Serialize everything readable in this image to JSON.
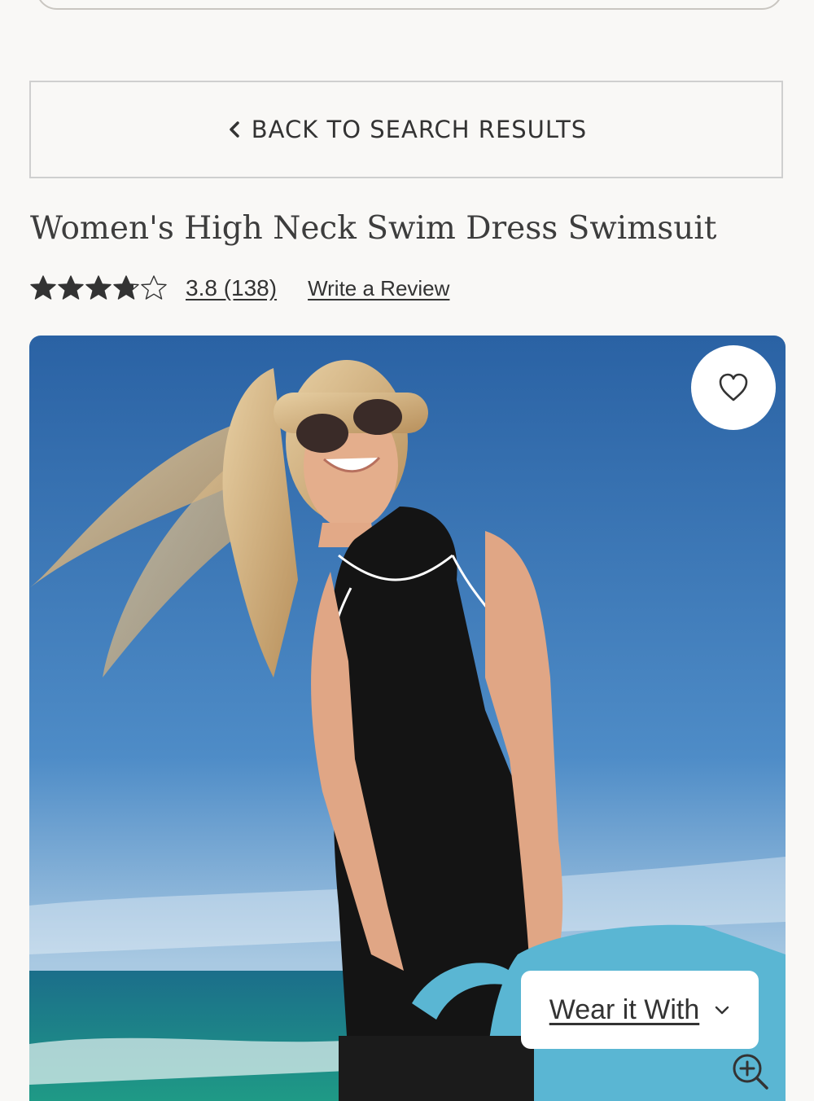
{
  "nav": {
    "back_label": "BACK TO SEARCH RESULTS",
    "back_icon": "chevron-left-icon"
  },
  "product": {
    "title": "Women's High Neck Swim Dress Swimsuit",
    "rating_value": 3.8,
    "rating_max": 5,
    "rating_link": "3.8 (138)",
    "review_link": "Write a Review"
  },
  "hero": {
    "favorite_icon": "heart-icon",
    "wear_it_with_label": "Wear it With",
    "wear_it_with_icon": "chevron-down-icon",
    "zoom_icon": "zoom-in-icon"
  },
  "colors": {
    "background": "#f9f8f6",
    "text": "#333333",
    "sky": "#2f6fb0",
    "sea": "#1f8a80",
    "dress": "#141414",
    "bag": "#5ab6d3"
  }
}
